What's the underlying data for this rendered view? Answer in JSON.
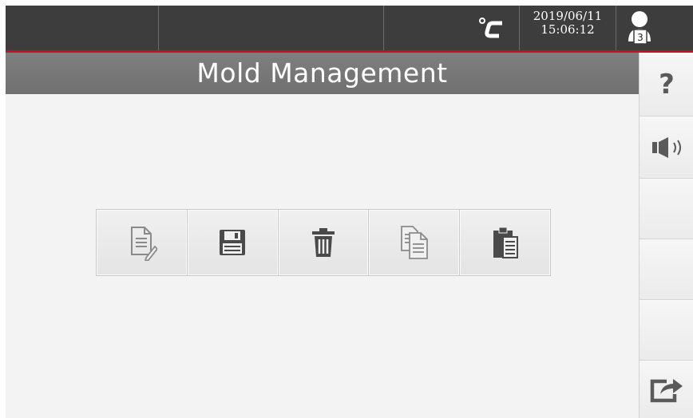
{
  "status": {
    "temperature_unit": "°C",
    "date": "2019/06/11",
    "time": "15:06:12",
    "user_level": "3"
  },
  "page": {
    "title": "Mold Management"
  },
  "toolbar": {
    "buttons": [
      {
        "name": "edit",
        "icon": "edit-document-icon"
      },
      {
        "name": "save",
        "icon": "floppy-disk-icon"
      },
      {
        "name": "delete",
        "icon": "trash-icon"
      },
      {
        "name": "copy",
        "icon": "copy-icon"
      },
      {
        "name": "paste",
        "icon": "clipboard-paste-icon"
      }
    ]
  },
  "sidebar": {
    "help_label": "?",
    "buttons": [
      "help-icon",
      "speaker-icon",
      "",
      "",
      "",
      "export-icon"
    ]
  },
  "colors": {
    "topbar": "#3d3d3d",
    "accent_line": "#c8102e",
    "title_bar": "#767676",
    "content_bg": "#f3f3f3"
  }
}
